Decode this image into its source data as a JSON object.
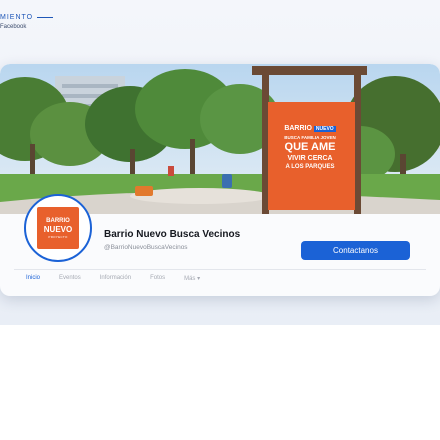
{
  "caption": {
    "title": "MIENTO",
    "subtitle": "Facebook"
  },
  "cover": {
    "sign": {
      "brand_left": "BARRIO",
      "brand_badge": "NUEVO",
      "line1": "BUSCA FAMILIA JOVEN",
      "line2": "QUE AME",
      "line3": "VIVIR CERCA",
      "line4": "A LOS PARQUES"
    }
  },
  "profile": {
    "logo_line1": "BARRIO",
    "logo_line2": "NUEVO",
    "logo_line3": "PROYECTO",
    "name": "Barrio Nuevo Busca Vecinos",
    "handle": "@BarrioNuevoBuscaVecinos",
    "contact_label": "Contactanos"
  },
  "tabs": [
    {
      "label": "Inicio"
    },
    {
      "label": "Eventos"
    },
    {
      "label": "Información"
    },
    {
      "label": "Fotos"
    },
    {
      "label": "Más ▾"
    }
  ],
  "colors": {
    "accent": "#1b62d6",
    "brand_orange": "#e8602c"
  }
}
